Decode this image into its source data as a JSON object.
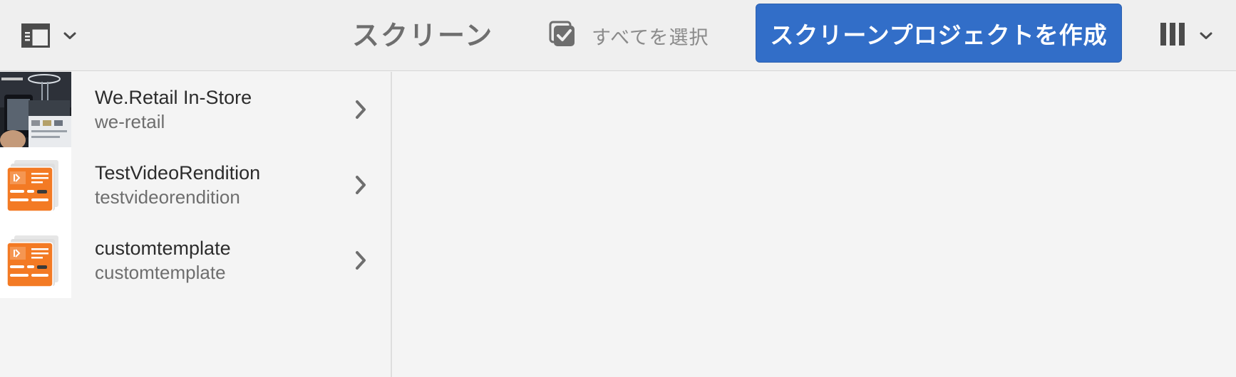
{
  "toolbar": {
    "title": "スクリーン",
    "select_all_label": "すべてを選択",
    "create_button_label": "スクリーンプロジェクトを作成",
    "rail_toggle_icon": "rail-left-icon",
    "view_switcher_icon": "column-view-icon"
  },
  "colors": {
    "accent": "#326ec8",
    "toolbar_bg": "#efefef",
    "page_bg": "#f4f4f4",
    "template_orange": "#f37a24"
  },
  "items": [
    {
      "title": "We.Retail In-Store",
      "subtitle": "we-retail",
      "thumbnail": "we-retail-store-photo"
    },
    {
      "title": "TestVideoRendition",
      "subtitle": "testvideorendition",
      "thumbnail": "screens-template-icon"
    },
    {
      "title": "customtemplate",
      "subtitle": "customtemplate",
      "thumbnail": "screens-template-icon"
    }
  ]
}
